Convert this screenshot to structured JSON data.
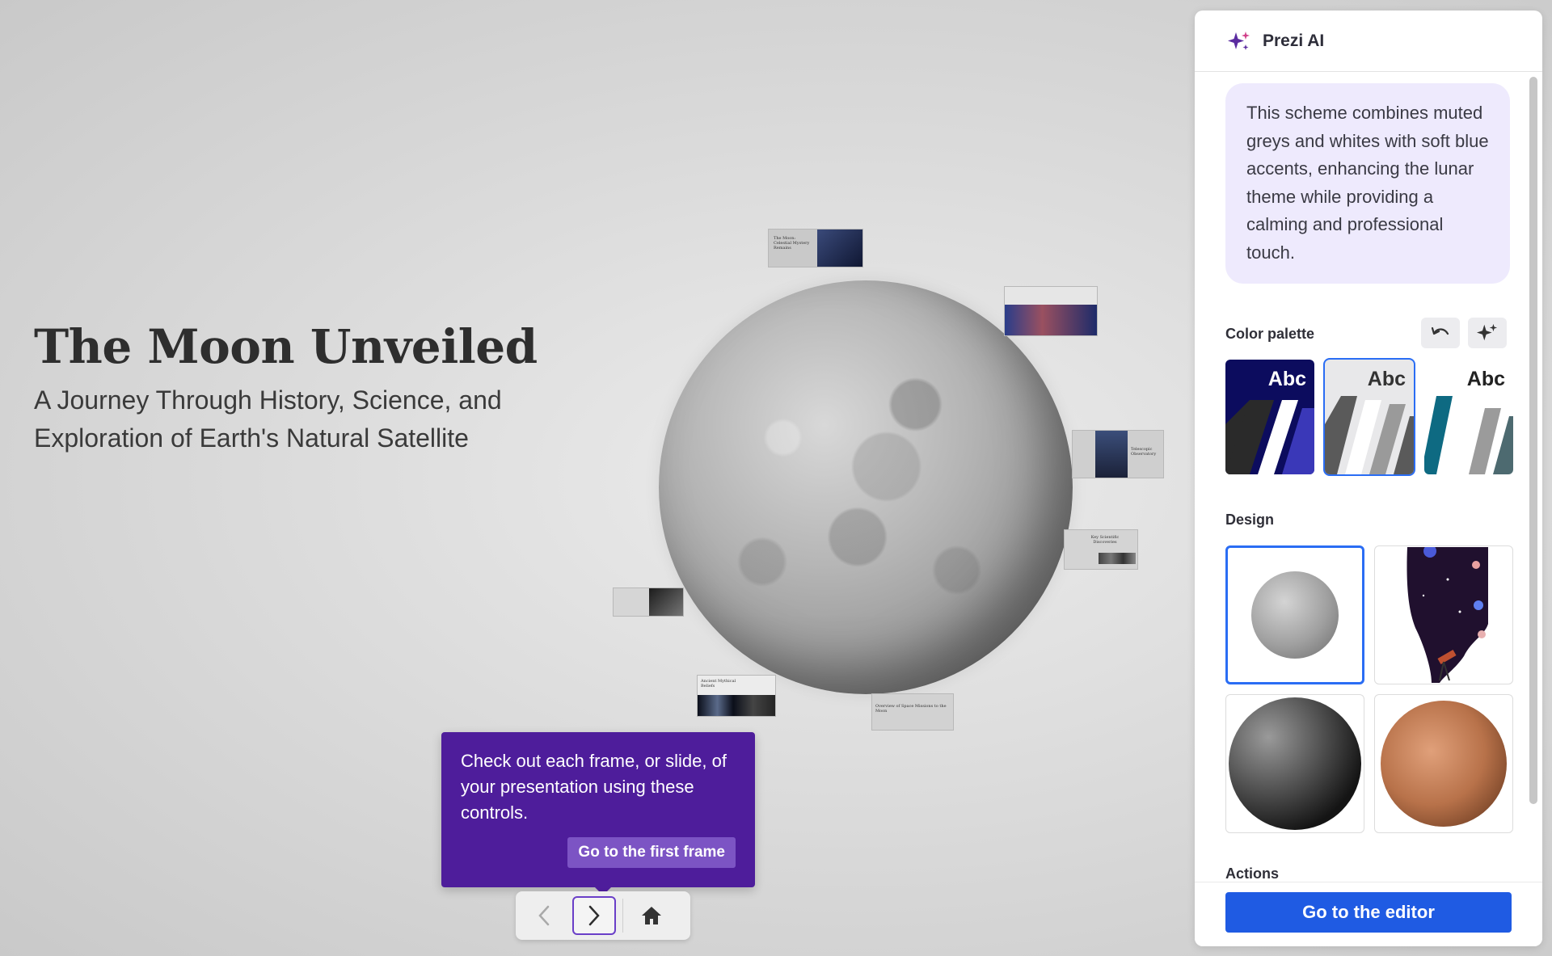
{
  "presentation": {
    "title": "The Moon Unveiled",
    "subtitle": "A Journey Through History, Science, and Exploration of Earth's Natural Satellite",
    "frames": [
      {
        "text": "The Moon: Celestial Mystery Remains"
      },
      {
        "text": ""
      },
      {
        "text": "Telescopic Observatory"
      },
      {
        "text": "Key Scientific Discoveries"
      },
      {
        "text": "Overview of Space Missions to the Moon"
      },
      {
        "text": "Ancient Mythical Beliefs"
      },
      {
        "text": ""
      }
    ]
  },
  "tooltip": {
    "text": "Check out each frame, or slide, of your presentation using these controls.",
    "button": "Go to the first frame"
  },
  "nav": {
    "prev_icon": "chevron-left-icon",
    "next_icon": "chevron-right-icon",
    "home_icon": "home-icon"
  },
  "panel": {
    "title": "Prezi AI",
    "message": "This scheme combines muted greys and whites with soft blue accents, enhancing the lunar theme while providing a calming and professional touch.",
    "color_palette_label": "Color palette",
    "palettes": [
      {
        "label": "Abc",
        "colors": [
          "#0c0c5e",
          "#2a2a2a",
          "#ffffff",
          "#3a38b8"
        ]
      },
      {
        "label": "Abc",
        "colors": [
          "#e8e8ea",
          "#5a5a5a",
          "#ffffff",
          "#9a9a9a"
        ],
        "selected": true
      },
      {
        "label": "Abc",
        "colors": [
          "#ffffff",
          "#0e6a82",
          "#ffffff",
          "#9b9b9b"
        ]
      }
    ],
    "design_label": "Design",
    "designs": [
      "moon",
      "space-telescope",
      "dark-moon",
      "mars"
    ],
    "actions_label": "Actions",
    "editor_button": "Go to the editor",
    "accent": "#1f5be3"
  }
}
